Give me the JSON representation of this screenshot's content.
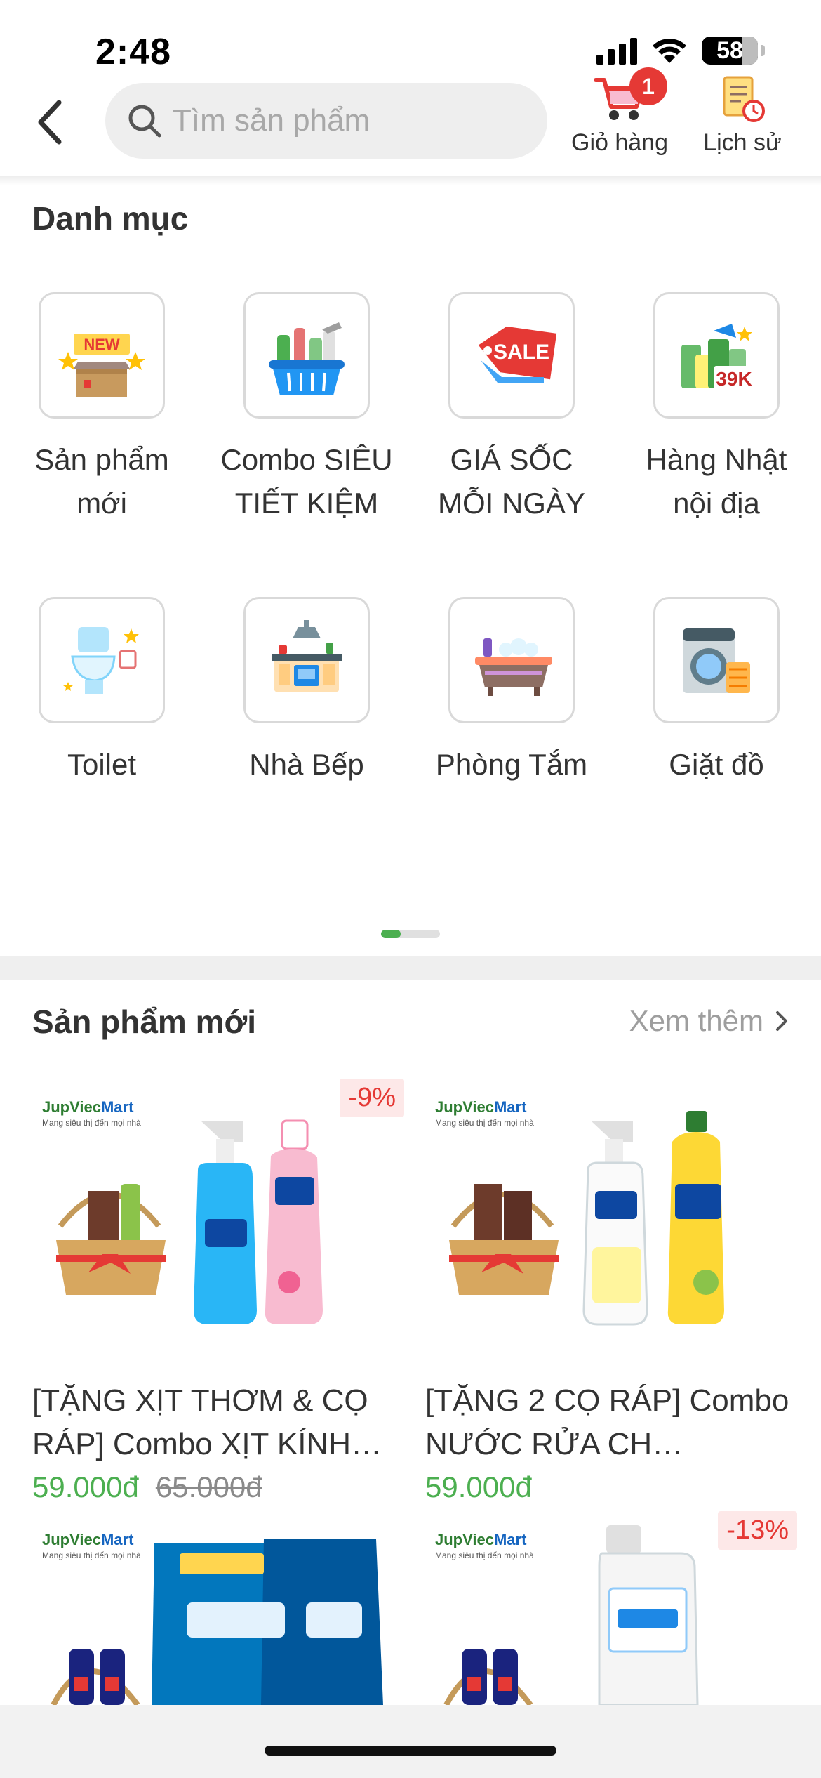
{
  "status_bar": {
    "time": "2:48",
    "battery": "58"
  },
  "header": {
    "search_placeholder": "Tìm sản phẩm",
    "cart_label": "Giỏ hàng",
    "cart_count": "1",
    "history_label": "Lịch sử"
  },
  "categories": {
    "title": "Danh mục",
    "items": [
      {
        "label": "Sản phẩm mới",
        "icon": "new-box-icon"
      },
      {
        "label": "Combo SIÊU TIẾT KIỆM",
        "icon": "basket-icon"
      },
      {
        "label": "GIÁ SỐC MỖI NGÀY",
        "icon": "sale-tag-icon"
      },
      {
        "label": "Hàng Nhật nội địa",
        "icon": "39k-products-icon"
      },
      {
        "label": "Toilet",
        "icon": "toilet-icon"
      },
      {
        "label": "Nhà Bếp",
        "icon": "kitchen-icon"
      },
      {
        "label": "Phòng Tắm",
        "icon": "bathtub-icon"
      },
      {
        "label": "Giặt đồ",
        "icon": "washing-machine-icon"
      }
    ],
    "sale_text": "SALE",
    "new_text": "NEW",
    "price_badge_text": "39K",
    "pager": {
      "pages": 2,
      "current": 1
    }
  },
  "products": {
    "title": "Sản phẩm mới",
    "see_more": "Xem thêm",
    "brand_name": "JupViec",
    "brand_suffix": "Mart",
    "brand_tagline": "Mang siêu thị đến mọi nhà",
    "items": [
      {
        "name": "[TẶNG XỊT THƠM & CỌ RÁP] Combo XỊT KÍNH…",
        "price": "59.000đ",
        "old_price": "65.000đ",
        "discount": "-9%"
      },
      {
        "name": "[TẶNG 2 CỌ RÁP] Combo NƯỚC RỬA CH…",
        "price": "59.000đ",
        "old_price": "",
        "discount": ""
      },
      {
        "name": "",
        "price": "",
        "old_price": "",
        "discount": ""
      },
      {
        "name": "",
        "price": "",
        "old_price": "",
        "discount": "-13%"
      }
    ]
  },
  "colors": {
    "accent_green": "#4caf50",
    "badge_red": "#e53935"
  }
}
